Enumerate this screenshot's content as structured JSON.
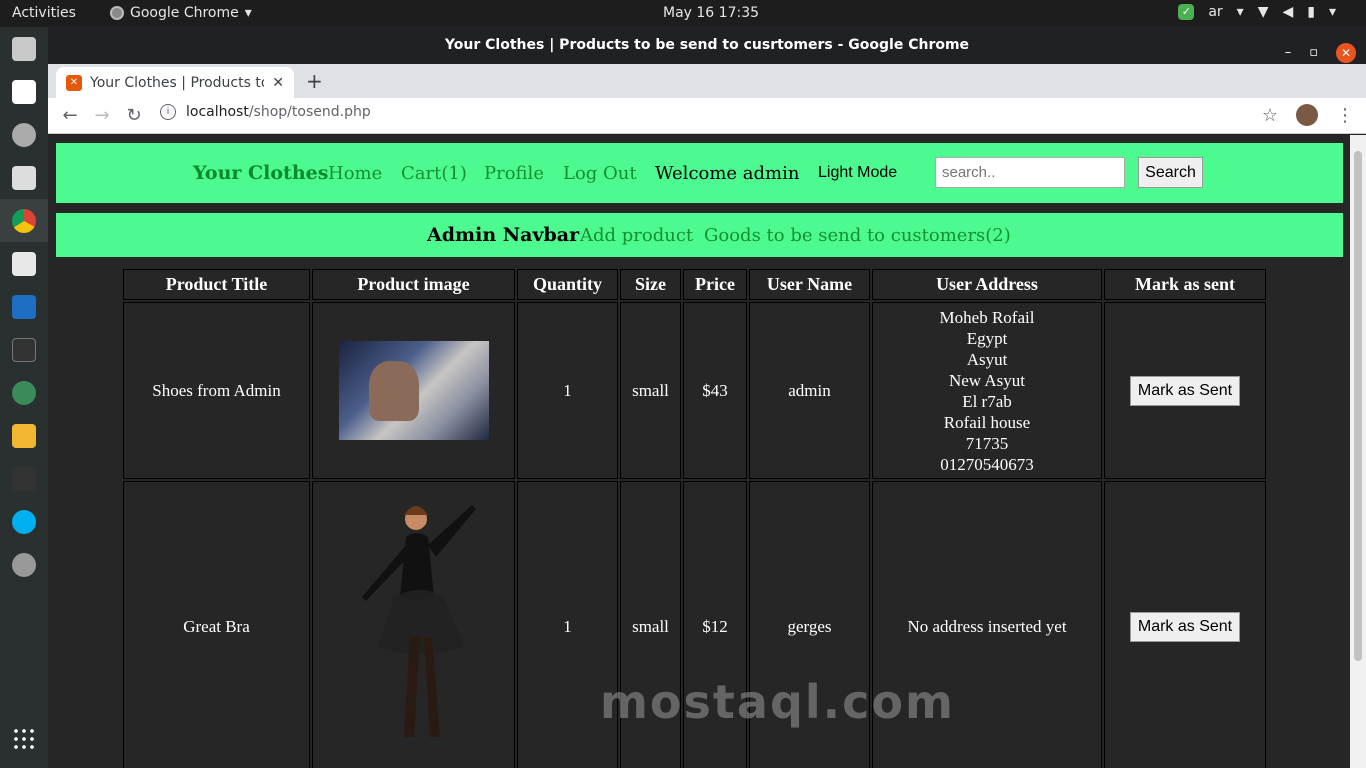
{
  "system": {
    "activities": "Activities",
    "app_name": "Google Chrome",
    "clock": "May 16  17:35",
    "lang": "ar"
  },
  "window": {
    "title": "Your Clothes | Products to be send to cusrtomers - Google Chrome"
  },
  "tab": {
    "title": "Your Clothes | Products to be send to cusrtomers"
  },
  "omnibox": {
    "host": "localhost",
    "path": "/shop/tosend.php"
  },
  "nav": {
    "brand": "Your Clothes",
    "home": "Home",
    "cart": "Cart(1)",
    "profile": "Profile",
    "logout": "Log Out",
    "welcome": "Welcome admin",
    "mode": "Light Mode",
    "search_placeholder": "search..",
    "search_btn": "Search"
  },
  "admin_nav": {
    "title": "Admin Navbar",
    "add": "Add product",
    "goods": "Goods to be send to customers(2)"
  },
  "table": {
    "headers": [
      "Product Title",
      "Product image",
      "Quantity",
      "Size",
      "Price",
      "User Name",
      "User Address",
      "Mark as sent"
    ],
    "rows": [
      {
        "title": "Shoes from Admin",
        "qty": "1",
        "size": "small",
        "price": "$43",
        "user": "admin",
        "address": [
          "Moheb Rofail",
          "Egypt",
          "Asyut",
          "New Asyut",
          "El r7ab",
          "Rofail house",
          "71735",
          "01270540673"
        ],
        "btn": "Mark as Sent"
      },
      {
        "title": "Great Bra",
        "qty": "1",
        "size": "small",
        "price": "$12",
        "user": "gerges",
        "address_text": "No address inserted yet",
        "btn": "Mark as Sent"
      }
    ]
  },
  "watermark": "mostaql.com"
}
